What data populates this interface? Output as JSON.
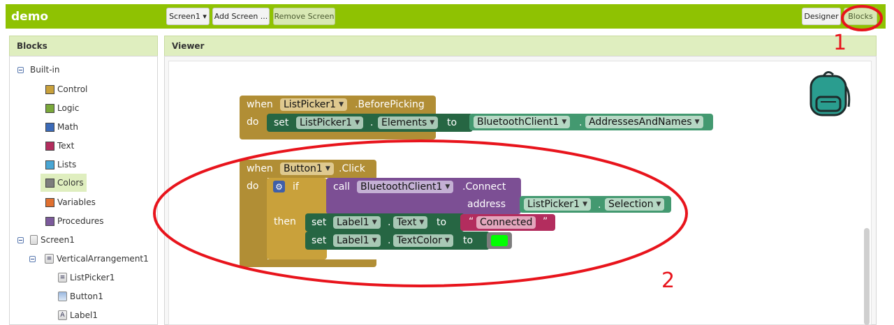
{
  "app": {
    "title": "demo"
  },
  "toolbar": {
    "screen_select": "Screen1 ▾",
    "add_screen": "Add Screen ...",
    "remove_screen": "Remove Screen",
    "designer": "Designer",
    "blocks": "Blocks"
  },
  "panels": {
    "blocks_title": "Blocks",
    "viewer_title": "Viewer"
  },
  "tree": {
    "builtin": "Built-in",
    "categories": [
      {
        "label": "Control",
        "color": "#c9a13b"
      },
      {
        "label": "Logic",
        "color": "#7aa83a"
      },
      {
        "label": "Math",
        "color": "#3b6ab8"
      },
      {
        "label": "Text",
        "color": "#b32d5e"
      },
      {
        "label": "Lists",
        "color": "#49a6d4"
      },
      {
        "label": "Colors",
        "color": "#7d7d7d"
      },
      {
        "label": "Variables",
        "color": "#e07030"
      },
      {
        "label": "Procedures",
        "color": "#7c5a9c"
      }
    ],
    "screen": "Screen1",
    "vertical": "VerticalArrangement1",
    "components": [
      "ListPicker1",
      "Button1",
      "Label1"
    ]
  },
  "blocks": {
    "b1": {
      "when": "when",
      "component": "ListPicker1",
      "event": ".BeforePicking",
      "do": "do",
      "set": "set",
      "target": "ListPicker1",
      "dot": ".",
      "property": "Elements",
      "to": "to",
      "value_component": "BluetoothClient1",
      "value_property": "AddressesAndNames"
    },
    "b2": {
      "when": "when",
      "component": "Button1",
      "event": ".Click",
      "do": "do",
      "if": "if",
      "call": "call",
      "call_component": "BluetoothClient1",
      "call_method": ".Connect",
      "address": "address",
      "addr_component": "ListPicker1",
      "addr_property": "Selection",
      "then": "then",
      "set1": "set",
      "set1_comp": "Label1",
      "set1_prop": "Text",
      "to": "to",
      "quote_open": "“",
      "text_value": "Connected",
      "quote_close": "”",
      "set2": "set",
      "set2_comp": "Label1",
      "set2_prop": "TextColor",
      "color_value": "#00ff00"
    }
  },
  "annotations": {
    "one": "1",
    "two": "2"
  },
  "colors": {
    "toolbar_green": "#8fc202",
    "event_block": "#b18e35",
    "setter_block": "#266643",
    "getter_block": "#439970",
    "call_block": "#7c4f94",
    "text_block": "#b32d5e",
    "annotation_red": "#e8141c"
  }
}
